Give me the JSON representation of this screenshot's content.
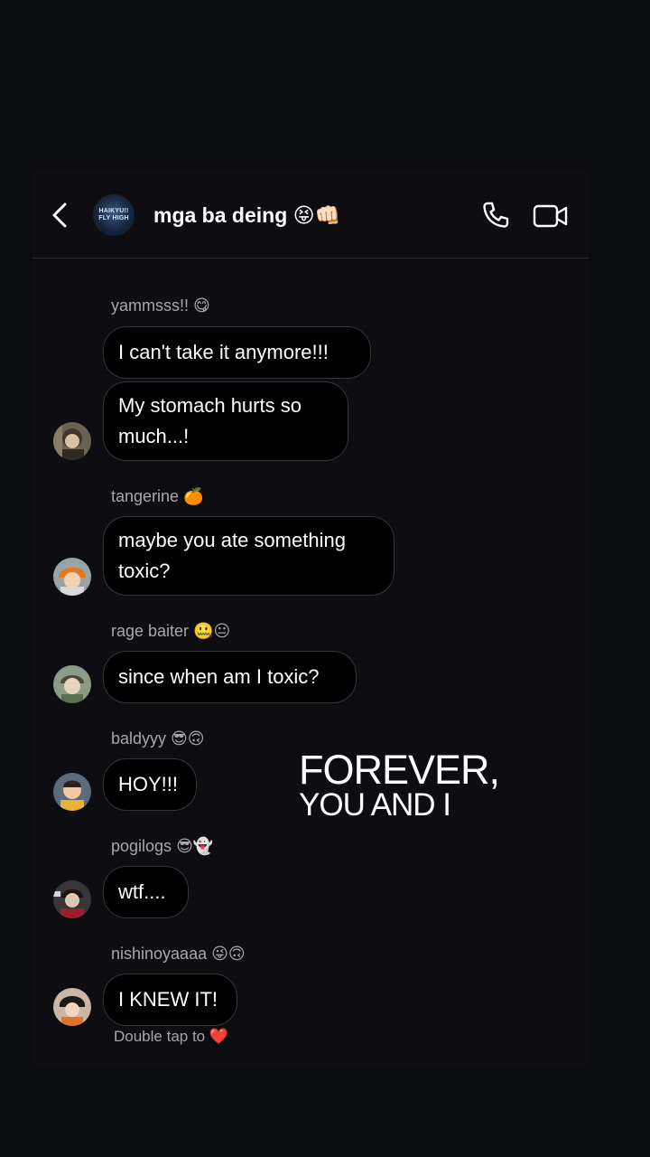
{
  "header": {
    "back_icon": "chevron-left-icon",
    "group_avatar_text": "HAIKYU!! FLY HIGH",
    "group_name": "mga ba deing",
    "group_emojis": "😝👊🏻",
    "call_icon": "phone-icon",
    "video_icon": "video-camera-icon"
  },
  "messages": [
    {
      "sender": "yammsss!!",
      "sender_emojis": "😋",
      "bubbles": [
        "I can't take it anymore!!!",
        "My stomach hurts so\nmuch...!"
      ]
    },
    {
      "sender": "tangerine",
      "sender_emojis": "🍊",
      "bubbles": [
        "maybe you ate something\ntoxic?"
      ]
    },
    {
      "sender": "rage baiter",
      "sender_emojis": "🤐😐",
      "bubbles": [
        "since when am I toxic?"
      ]
    },
    {
      "sender": "baldyyy",
      "sender_emojis": "😎🙃",
      "bubbles": [
        "HOY!!!"
      ]
    },
    {
      "sender": "pogilogs",
      "sender_emojis": "😎👻",
      "bubbles": [
        "wtf...."
      ]
    },
    {
      "sender": "nishinoyaaaa",
      "sender_emojis": "😜🙃",
      "bubbles": [
        "I KNEW IT!"
      ]
    }
  ],
  "overlay": {
    "line1": "FOREVER,",
    "line2": "YOU AND I"
  },
  "hint": {
    "text": "Double tap to",
    "heart": "❤️"
  },
  "colors": {
    "background": "#0b0c10",
    "bubble_border": "#34353b",
    "muted_text": "#a6a7ad"
  }
}
